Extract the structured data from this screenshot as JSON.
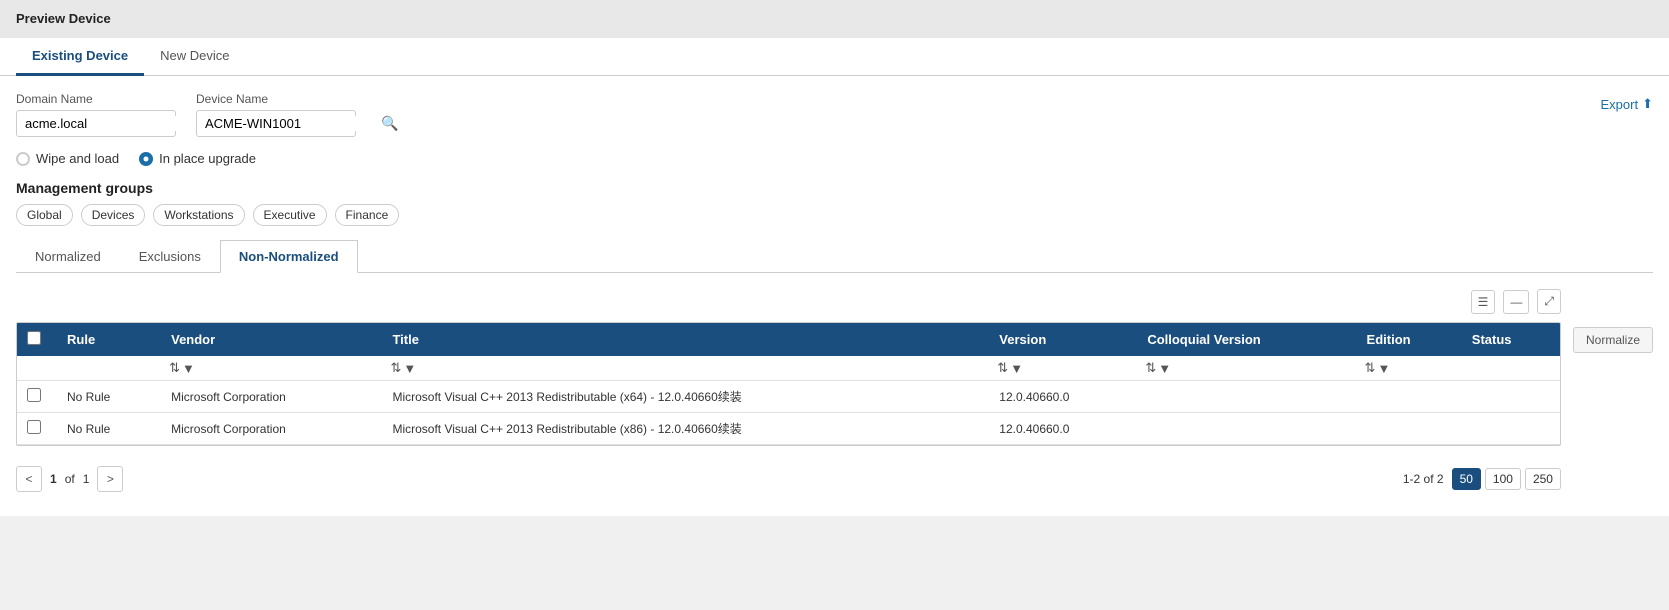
{
  "page": {
    "title": "Preview Device"
  },
  "tabs": {
    "items": [
      {
        "label": "Existing Device",
        "active": true
      },
      {
        "label": "New Device",
        "active": false
      }
    ]
  },
  "form": {
    "domain_name_label": "Domain Name",
    "domain_name_value": "acme.local",
    "domain_name_placeholder": "acme.local",
    "device_name_label": "Device Name",
    "device_name_value": "ACME-WIN1001",
    "device_name_placeholder": "ACME-WIN1001",
    "export_label": "Export",
    "wipe_load_label": "Wipe and load",
    "in_place_label": "In place upgrade"
  },
  "management": {
    "title": "Management groups",
    "tags": [
      "Global",
      "Devices",
      "Workstations",
      "Executive",
      "Finance"
    ]
  },
  "inner_tabs": {
    "items": [
      {
        "label": "Normalized",
        "active": false
      },
      {
        "label": "Exclusions",
        "active": false
      },
      {
        "label": "Non-Normalized",
        "active": true
      }
    ]
  },
  "toolbar": {
    "columns_icon": "☰",
    "collapse_icon": "—",
    "expand_icon": "↗",
    "normalize_btn": "Normalize"
  },
  "table": {
    "columns": [
      {
        "key": "checkbox",
        "label": ""
      },
      {
        "key": "rule",
        "label": "Rule"
      },
      {
        "key": "vendor",
        "label": "Vendor"
      },
      {
        "key": "title",
        "label": "Title"
      },
      {
        "key": "version",
        "label": "Version"
      },
      {
        "key": "colloquial",
        "label": "Colloquial Version"
      },
      {
        "key": "edition",
        "label": "Edition"
      },
      {
        "key": "status",
        "label": "Status"
      }
    ],
    "rows": [
      {
        "rule": "No Rule",
        "vendor": "Microsoft Corporation",
        "title": "Microsoft Visual C++ 2013 Redistributable (x64) - 12.0.40660续装",
        "version": "12.0.40660.0",
        "colloquial": "",
        "edition": "",
        "status": ""
      },
      {
        "rule": "No Rule",
        "vendor": "Microsoft Corporation",
        "title": "Microsoft Visual C++ 2013 Redistributable (x86) - 12.0.40660续装",
        "version": "12.0.40660.0",
        "colloquial": "",
        "edition": "",
        "status": ""
      }
    ]
  },
  "pagination": {
    "current_page": "1",
    "of_label": "of",
    "total_pages": "1",
    "results_label": "1-2 of 2",
    "page_sizes": [
      "50",
      "100",
      "250"
    ],
    "active_page_size": "50"
  }
}
